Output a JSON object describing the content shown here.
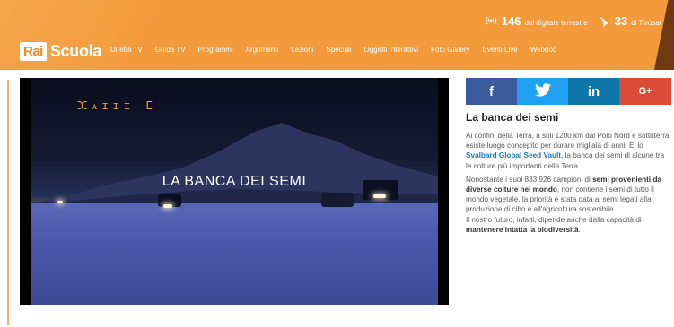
{
  "header": {
    "stats": [
      {
        "icon": "signal-icon",
        "value": "146",
        "label": "del digitale terrestre"
      },
      {
        "icon": "satellite-dish-icon",
        "value": "33",
        "label": "di Tivùsat"
      }
    ],
    "logo": {
      "rai": "Rai",
      "scuola": "Scuola"
    },
    "nav": [
      "Diretta TV",
      "Guida TV",
      "Programmi",
      "Argomenti",
      "Lezioni",
      "Speciali",
      "Oggetti Interattivi",
      "Foto Gallery",
      "Eventi Live",
      "Webdoc"
    ]
  },
  "video": {
    "title": "LA BANCA DEI SEMI",
    "corner_text": "ⵋᴀɪɪɪ ⵎ"
  },
  "social": {
    "facebook": "f",
    "twitter": "twitter",
    "linkedin": "in",
    "googleplus": "G+"
  },
  "article": {
    "title": "La banca dei semi",
    "p1_a": "Ai confini della Terra, a soli 1200 km dal Polo Nord e sottoterra, esiste luogo concepito per durare migliaia di anni. E' lo ",
    "p1_link": "Svalbard Global Seed Vault",
    "p1_b": ", la banca dei semi di alcune tra le colture più importanti della Terra.",
    "p2_a": "Nonostante i suoi 833.926 campioni di ",
    "p2_bold": "semi provenienti da diverse colture nel mondo",
    "p2_b": ", non contiene i semi di tutto il mondo vegetale, la priorità è stata data ai semi legati alla produzione di cibo e all'agricoltura sostenibile.",
    "p3_a": "Il nostro futuro, infatti, dipende anche dalla capacità di ",
    "p3_bold": "mantenere intatta la biodiversità",
    "p3_b": "."
  }
}
